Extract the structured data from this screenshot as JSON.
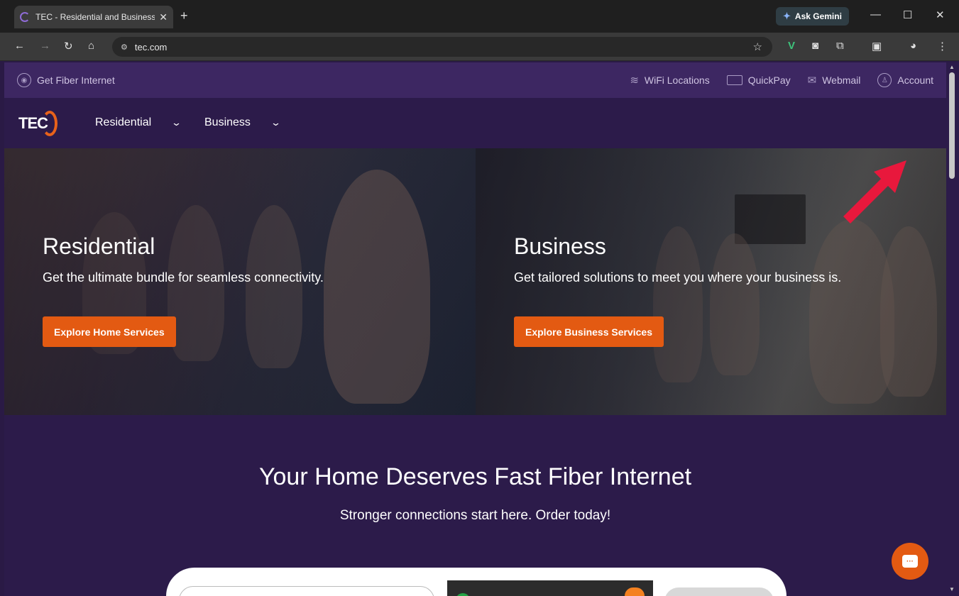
{
  "browser": {
    "tab_title": "TEC - Residential and Business I",
    "tab_close": "✕",
    "new_tab": "+",
    "gemini_label": "Ask Gemini",
    "url": "tec.com",
    "window_controls": [
      "—",
      "☐",
      "✕"
    ]
  },
  "utility_bar": {
    "left_item": "Get Fiber Internet",
    "right_items": [
      {
        "label": "WiFi Locations",
        "icon": "wifi-icon"
      },
      {
        "label": "QuickPay",
        "icon": "card-icon"
      },
      {
        "label": "Webmail",
        "icon": "mail-icon"
      },
      {
        "label": "Account",
        "icon": "user-icon"
      }
    ]
  },
  "main_nav": {
    "logo_text": "TEC",
    "links": [
      "Residential",
      "Business"
    ]
  },
  "hero": {
    "residential": {
      "title": "Residential",
      "subtitle": "Get the ultimate bundle for seamless connectivity.",
      "cta": "Explore Home Services"
    },
    "business": {
      "title": "Business",
      "subtitle": "Get tailored solutions to meet you where your business is.",
      "cta": "Explore Business Services"
    }
  },
  "fiber_section": {
    "title": "Your Home Deserves Fast Fiber Internet",
    "subtitle": "Stronger connections start here. Order today!"
  },
  "colors": {
    "brand_purple": "#2c1b4a",
    "utility_purple": "#3d2762",
    "accent_orange": "#e35a12",
    "annotation_red": "#e8183c"
  }
}
